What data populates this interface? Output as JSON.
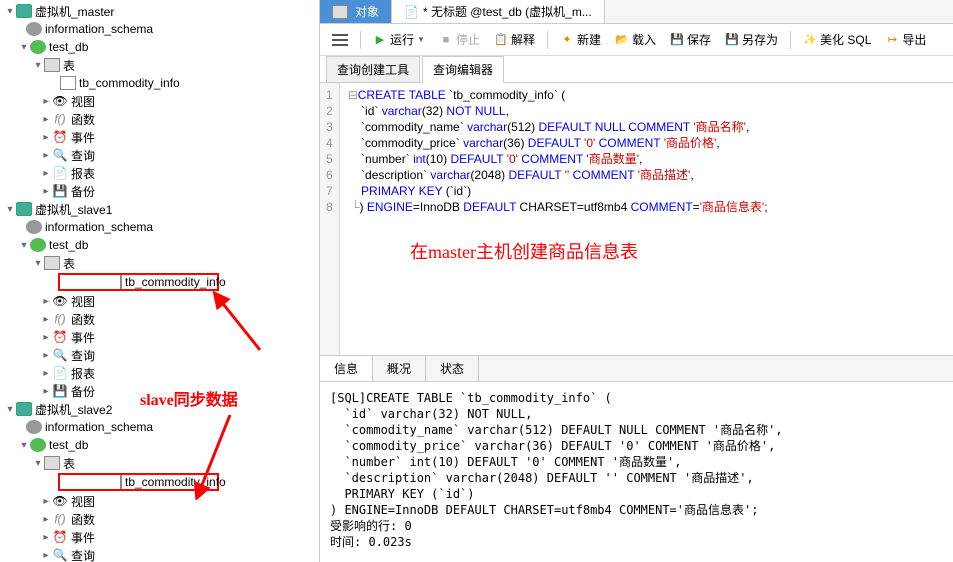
{
  "tree": {
    "conn1": "虚拟机_master",
    "schema": "information_schema",
    "db": "test_db",
    "tables": "表",
    "table": "tb_commodity_info",
    "view": "视图",
    "func": "函数",
    "event": "事件",
    "query": "查询",
    "report": "报表",
    "backup": "备份",
    "conn2": "虚拟机_slave1",
    "conn3": "虚拟机_slave2"
  },
  "annotations": {
    "slave_sync": "slave同步数据",
    "master_create": "在master主机创建商品信息表"
  },
  "tabs": {
    "object": "对象",
    "untitled": "* 无标题 @test_db (虚拟机_m..."
  },
  "toolbar": {
    "run": "运行",
    "stop": "停止",
    "explain": "解释",
    "new": "新建",
    "load": "载入",
    "save": "保存",
    "saveas": "另存为",
    "beautify": "美化 SQL",
    "export": "导出"
  },
  "subtabs": {
    "builder": "查询创建工具",
    "editor": "查询编辑器"
  },
  "sql": {
    "l1a": "CREATE TABLE",
    "l1b": "`tb_commodity_info`",
    "l1c": "(",
    "l2a": "`id`",
    "l2b": "varchar",
    "l2c": "(32)",
    "l2d": "NOT NULL",
    "l2e": ",",
    "l3a": "`commodity_name`",
    "l3b": "varchar",
    "l3c": "(512)",
    "l3d": "DEFAULT NULL COMMENT",
    "l3e": "'商品名称'",
    "l3f": ",",
    "l4a": "`commodity_price`",
    "l4b": "varchar",
    "l4c": "(36)",
    "l4d": "DEFAULT",
    "l4e": "'0'",
    "l4f": "COMMENT",
    "l4g": "'商品价格'",
    "l4h": ",",
    "l5a": "`number`",
    "l5b": "int",
    "l5c": "(10)",
    "l5d": "DEFAULT",
    "l5e": "'0'",
    "l5f": "COMMENT",
    "l5g": "'商品数量'",
    "l5h": ",",
    "l6a": "`description`",
    "l6b": "varchar",
    "l6c": "(2048)",
    "l6d": "DEFAULT",
    "l6e": "''",
    "l6f": "COMMENT",
    "l6g": "'商品描述'",
    "l6h": ",",
    "l7a": "PRIMARY KEY",
    "l7b": "(`id`)",
    "l8a": ")",
    "l8b": "ENGINE",
    "l8c": "=InnoDB",
    "l8d": "DEFAULT",
    "l8e": "CHARSET=utf8mb4",
    "l8f": "COMMENT",
    "l8g": "=",
    "l8h": "'商品信息表'",
    "l8i": ";"
  },
  "lines": [
    "1",
    "2",
    "3",
    "4",
    "5",
    "6",
    "7",
    "8"
  ],
  "output_tabs": {
    "info": "信息",
    "overview": "概况",
    "status": "状态"
  },
  "output": "[SQL]CREATE TABLE `tb_commodity_info` (\n  `id` varchar(32) NOT NULL,\n  `commodity_name` varchar(512) DEFAULT NULL COMMENT '商品名称',\n  `commodity_price` varchar(36) DEFAULT '0' COMMENT '商品价格',\n  `number` int(10) DEFAULT '0' COMMENT '商品数量',\n  `description` varchar(2048) DEFAULT '' COMMENT '商品描述',\n  PRIMARY KEY (`id`)\n) ENGINE=InnoDB DEFAULT CHARSET=utf8mb4 COMMENT='商品信息表';\n受影响的行: 0\n时间: 0.023s"
}
